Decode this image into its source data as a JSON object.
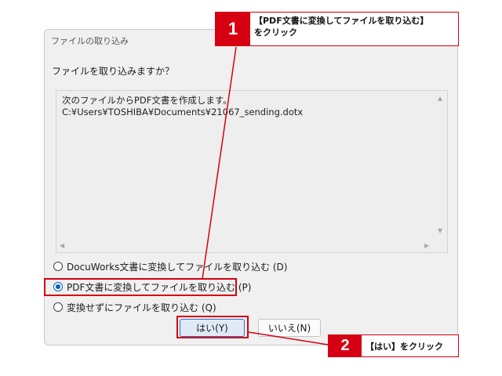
{
  "dialog": {
    "title": "ファイルの取り込み",
    "prompt": "ファイルを取り込みますか？",
    "message_line1": "次のファイルからPDF文書を作成します。",
    "message_line2": "C:¥Users¥TOSHIBA¥Documents¥21067_sending.dotx"
  },
  "options": [
    {
      "label": "DocuWorks文書に変換してファイルを取り込む (D)",
      "checked": false
    },
    {
      "label": "PDF文書に変換してファイルを取り込む (P)",
      "checked": true
    },
    {
      "label": "変換せずにファイルを取り込む (Q)",
      "checked": false
    }
  ],
  "buttons": {
    "yes": "はい(Y)",
    "no": "いいえ(N)"
  },
  "callouts": [
    {
      "number": "1",
      "line1": "【PDF文書に変換してファイルを取り込む】",
      "line2": "をクリック"
    },
    {
      "number": "2",
      "line1": "【はい】をクリック"
    }
  ],
  "colors": {
    "accent_red": "#d60012",
    "radio_blue": "#0060c0",
    "dialog_bg": "#f0f0f0"
  }
}
